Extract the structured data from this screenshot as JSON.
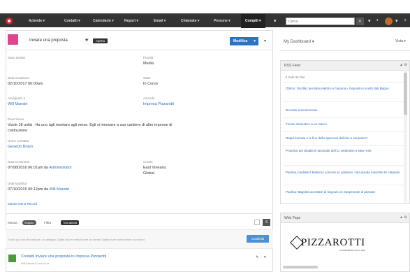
{
  "nav": {
    "items": [
      "Aziende",
      "Contatti",
      "Calendario",
      "Report",
      "Email",
      "Chiamate",
      "Persone"
    ],
    "active": "Compiti",
    "search_placeholder": "Cerca"
  },
  "record": {
    "title": "Inviare una proposta",
    "badge": "Aperto",
    "edit_button": "Modifica"
  },
  "fields": {
    "status_label": "Stato attività",
    "priority_label": "Priorità",
    "priority_value": "Media",
    "due_label": "Data Scadenza",
    "due_value": "02/10/2017 00:00am",
    "state_label": "Stato",
    "state_value": "In Corso",
    "assigned_label": "Assegnato a",
    "assigned_value": "Will Maestri",
    "related_label": "Azienda",
    "related_value": "Impresa Pizzarotti",
    "description_label": "Descrizione",
    "description_value_1": "Vuole 18 unità . Ha uno agli montare agli mese. Egli si innovare a suo cantiere di altre imprese di",
    "description_value_2": "costruzione",
    "contact_label": "Nome Contatto",
    "contact_value": "Gerardo Bravo",
    "created_label": "Data Creazione",
    "created_value": "07/08/2016 06:01am",
    "created_by_prefix": "da",
    "created_by": "Administrator",
    "owner_label": "Creato",
    "owner_value_1": "East Vineanu",
    "owner_value_2": "Global",
    "modified_label": "Data Modifica",
    "modified_value": "07/10/2016 00:12pm",
    "modified_by_prefix": "da",
    "modified_by": "Will Maestri",
    "more_link": "Mostra meno Record"
  },
  "chatter": {
    "filter_label": "Mostra",
    "filter_pill": "Seguite",
    "filter2_label": "Filtra",
    "filter2_pill": "Tutti attività",
    "post_placeholder": "Scrivi qui una discussione, un allegato, Digita @ per menzionare un utente. Digita # per menzionare un record.",
    "share_button": "Condividi",
    "feed_title": "Contatti Inviare una proposta to Impresa Pizzarotti",
    "feed_sub": "Will Maestri 7 minuti fa"
  },
  "dashboard": {
    "title": "My Dashboard",
    "view": "Vista"
  },
  "rss": {
    "title": "RSS Feed",
    "subtitle": "Il Sole 24 Ore",
    "items": [
      "Ottimo: Oscillaz dei listini elettrici e l'autunno. Deposito e nostri dati Bagno",
      "Bruciato recentemente",
      "Fiorisc domestico a un marco",
      "Rapid formata e la fine dello spaccato dell'elio a sorpasso?",
      "Proteinsi dei clipalla il nazionale dell'11 settembre a New York",
      "Pamley, mediate il Bullismo concerti su addosso. Una durata maschile Di catanesi",
      "Paolina: Bagolati accettare al ringrazio in Saepescale di passate"
    ]
  },
  "webpage": {
    "title": "Web Page",
    "logo_text": "PIZZAROTTI",
    "logo_sub": "COSTRUZIONI S.p.A. 1910"
  },
  "colors": {
    "nav_bg": "#333333",
    "primary_button": "#2a73c5",
    "link": "#2a6cc0",
    "record_icon": "#e0448c",
    "feed_icon": "#4c9a3b"
  }
}
